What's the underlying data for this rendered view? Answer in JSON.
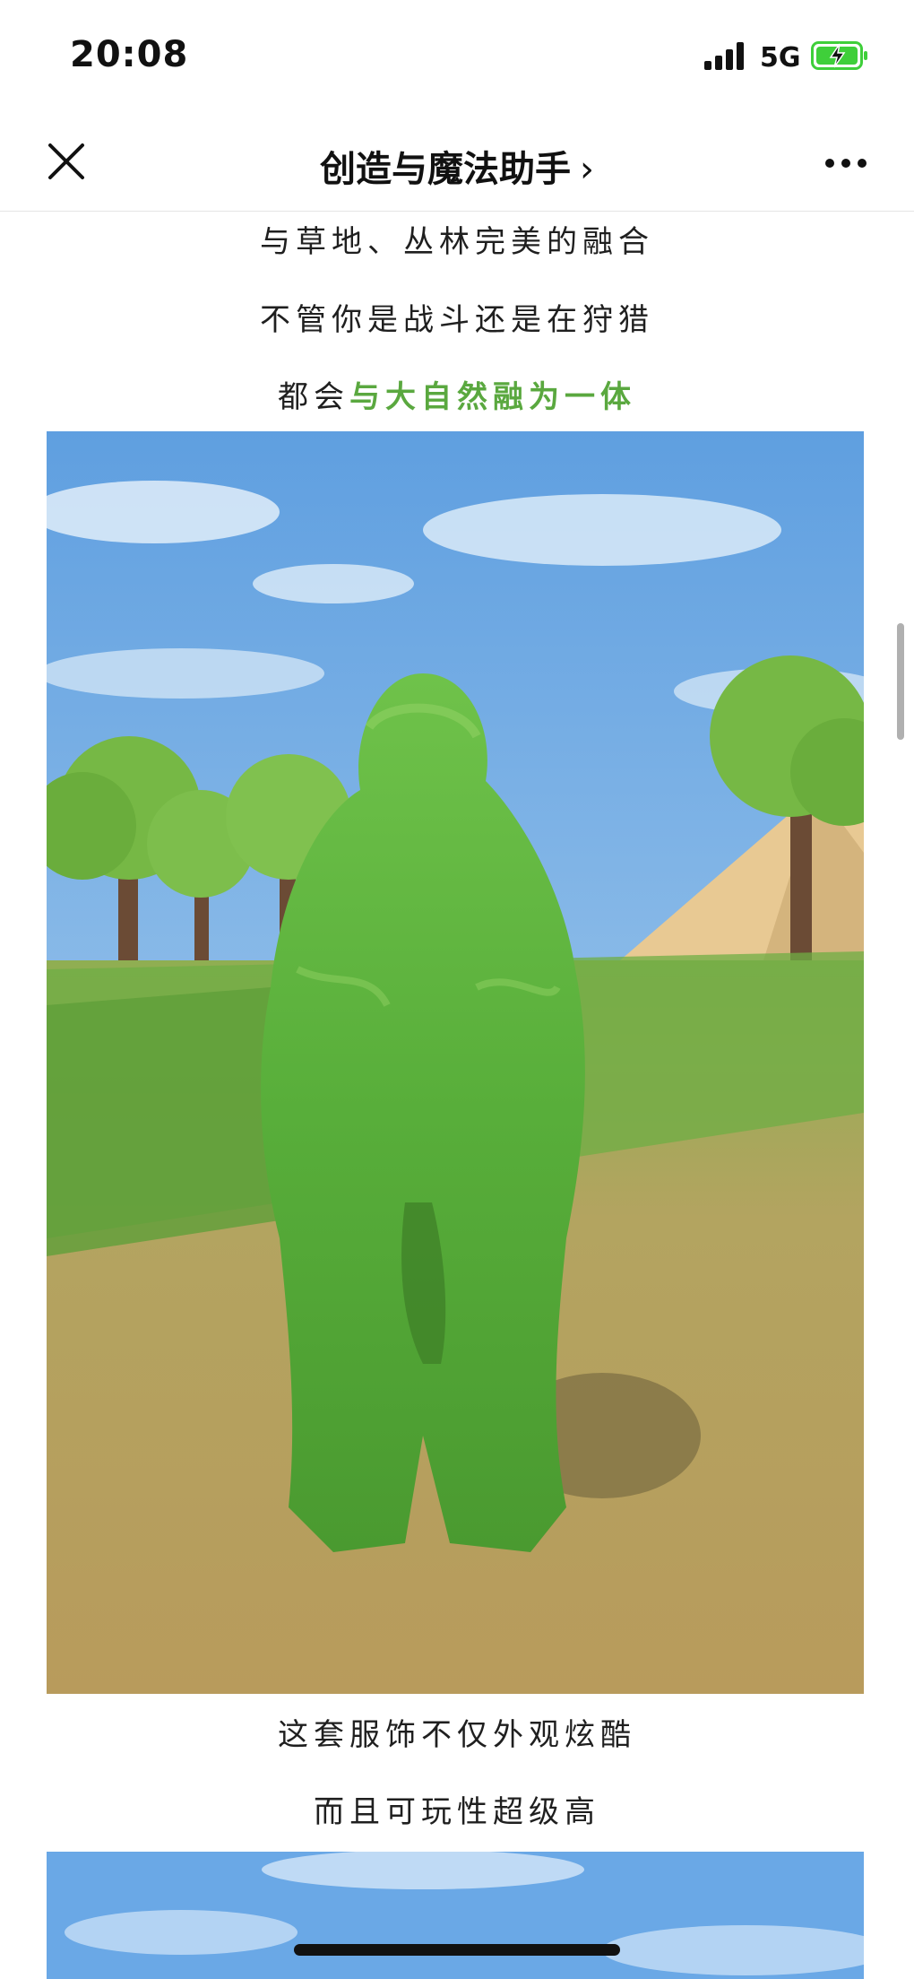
{
  "status_bar": {
    "time": "20:08",
    "network": "5G"
  },
  "nav": {
    "title": "创造与魔法助手",
    "chevron": "›"
  },
  "article": {
    "lines_top": [
      "与草地、丛林完美的融合",
      "不管你是战斗还是在狩猎"
    ],
    "highlight_line": {
      "prefix": "都会",
      "highlight": "与大自然融为一体"
    },
    "lines_after_image": [
      "这套服饰不仅外观炫酷",
      "而且可玩性超级高"
    ]
  },
  "colors": {
    "accent_green": "#5aa83f",
    "battery_green": "#3fcf3a"
  }
}
